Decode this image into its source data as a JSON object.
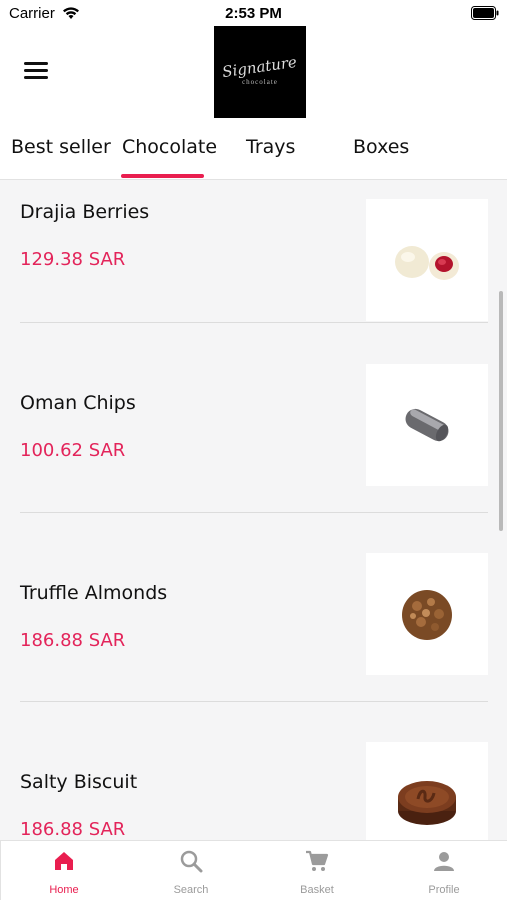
{
  "status_bar": {
    "carrier": "Carrier",
    "time": "2:53 PM"
  },
  "header": {
    "logo_script": "Signature",
    "logo_sub": "chocolate"
  },
  "tabs": [
    {
      "label": "Best seller"
    },
    {
      "label": "Chocolate",
      "active": true
    },
    {
      "label": "Trays"
    },
    {
      "label": "Boxes"
    }
  ],
  "products": [
    {
      "name": "Drajia Berries",
      "price": "129.38 SAR",
      "image": "berries-image"
    },
    {
      "name": "Oman Chips",
      "price": "100.62 SAR",
      "image": "chocolate-bar-image"
    },
    {
      "name": "Truffle Almonds",
      "price": "186.88 SAR",
      "image": "truffle-image"
    },
    {
      "name": "Salty Biscuit",
      "price": "186.88 SAR",
      "image": "biscuit-image"
    }
  ],
  "bottom_nav": [
    {
      "label": "Home",
      "icon": "home-icon",
      "active": true
    },
    {
      "label": "Search",
      "icon": "search-icon"
    },
    {
      "label": "Basket",
      "icon": "cart-icon"
    },
    {
      "label": "Profile",
      "icon": "profile-icon"
    }
  ],
  "colors": {
    "accent": "#e91e4f",
    "price": "#e3245a",
    "background": "#f5f5f6"
  }
}
